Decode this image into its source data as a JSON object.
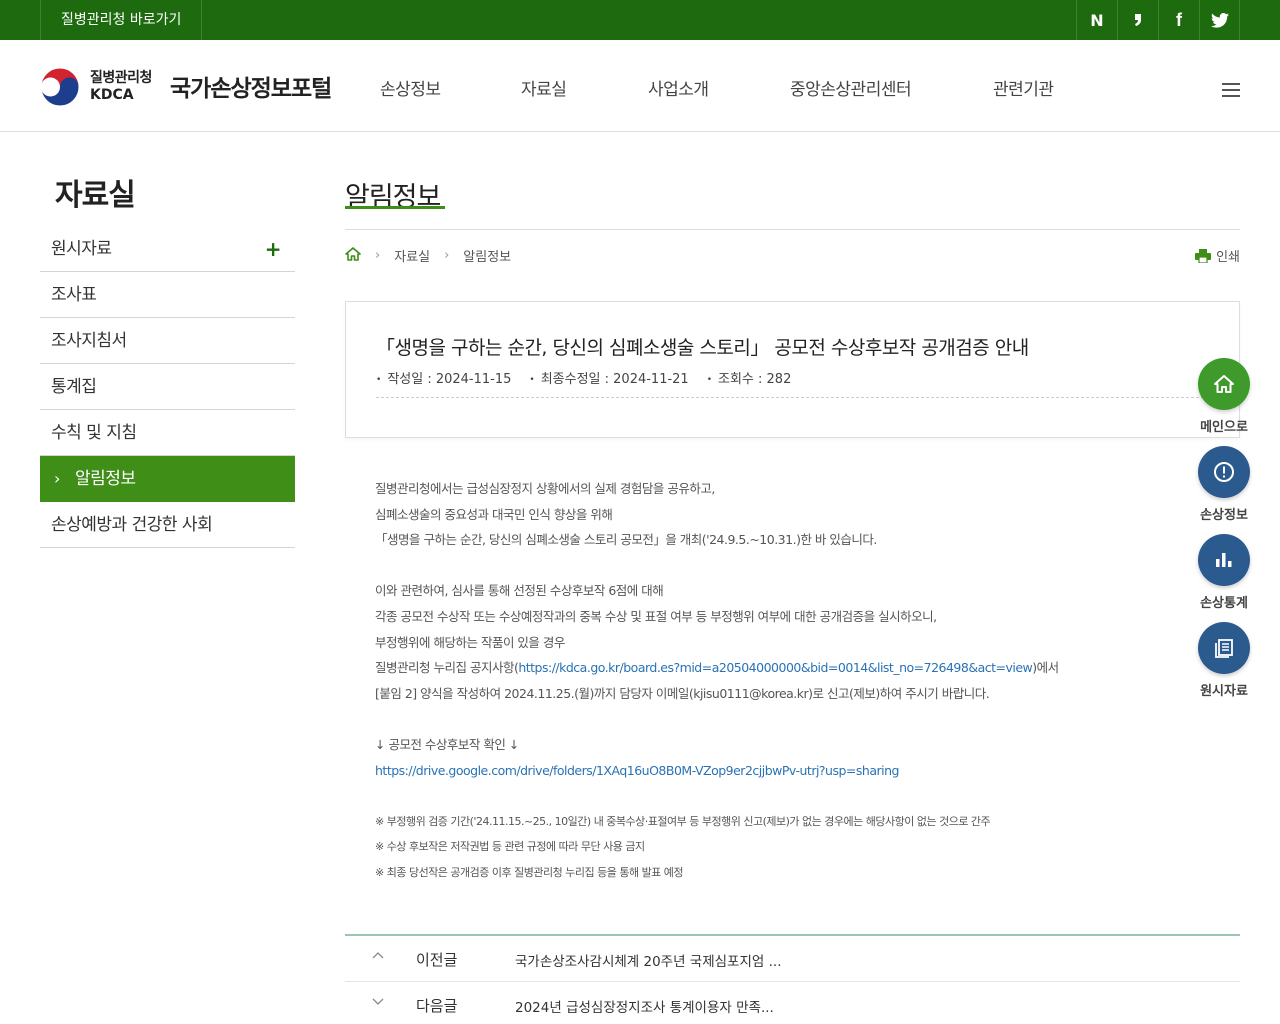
{
  "topbar": {
    "link_label": "질병관리청 바로가기",
    "sns": [
      {
        "icon": "naver-icon",
        "glyph": "N"
      },
      {
        "icon": "blog-icon",
        "glyph": "❜"
      },
      {
        "icon": "facebook-icon",
        "glyph": "f"
      },
      {
        "icon": "twitter-icon",
        "glyph": "t"
      }
    ]
  },
  "header": {
    "logo_ko": "질병관리청",
    "logo_en": "KDCA",
    "portal_title": "국가손상정보포털",
    "nav": [
      "손상정보",
      "자료실",
      "사업소개",
      "중앙손상관리센터",
      "관련기관"
    ]
  },
  "sidebar": {
    "title": "자료실",
    "items": [
      {
        "label": "원시자료",
        "expand": "+"
      },
      {
        "label": "조사표"
      },
      {
        "label": "조사지침서"
      },
      {
        "label": "통계집"
      },
      {
        "label": "수칙 및 지침"
      },
      {
        "label": "알림정보",
        "active": true
      },
      {
        "label": "손상예방과 건강한 사회"
      }
    ]
  },
  "content": {
    "page_title": "알림정보",
    "breadcrumb": [
      "자료실",
      "알림정보"
    ],
    "print_label": "인쇄"
  },
  "post": {
    "title": "「생명을 구하는 순간, 당신의 심폐소생술 스토리」 공모전 수상후보작 공개검증 안내",
    "meta": {
      "created": "작성일 : 2024-11-15",
      "modified": "최종수정일 : 2024-11-21",
      "views": "조회수 : 282"
    },
    "body": {
      "p1": "질병관리청에서는 급성심장정지 상황에서의 실제 경험담을 공유하고,",
      "p2": "심폐소생술의 중요성과 대국민 인식 향상을 위해",
      "p3": "「생명을 구하는 순간, 당신의 심폐소생술 스토리 공모전」을 개최('24.9.5.~10.31.)한 바 있습니다.",
      "p4": "이와 관련하여, 심사를 통해 선정된 수상후보작 6점에 대해",
      "p5": "각종 공모전 수상작 또는 수상예정작과의 중복 수상 및 표절 여부 등 부정행위 여부에 대한 공개검증을 실시하오니,",
      "p6": "부정행위에 해당하는 작품이 있을 경우",
      "p7_pre": "질병관리청 누리집 공지사항(",
      "p7_link": "https://kdca.go.kr/board.es?mid=a20504000000&bid=0014&list_no=726498&act=view",
      "p7_post": ")에서",
      "p8": "[붙임 2] 양식을 작성하여 2024.11.25.(월)까지 담당자 이메일(kjisu0111@korea.kr)로 신고(제보)하여 주시기 바랍니다.",
      "p9": "↓ 공모전 수상후보작 확인 ↓",
      "p10_link": "https://drive.google.com/drive/folders/1XAq16uO8B0M-VZop9er2cjjbwPv-utrj?usp=sharing",
      "n1": "※ 부정행위 검증 기간('24.11.15.~25., 10일간) 내 중복수상·표절여부 등 부정행위 신고(제보)가 없는 경우에는 해당사항이 없는 것으로 간주",
      "n2": "※ 수상 후보작은 저작권법 등 관련 규정에 따라 무단 사용 금지",
      "n3": "※ 최종 당선작은 공개검증 이후 질병관리청 누리집 등을 통해 발표 예정"
    }
  },
  "prevnext": {
    "prev_label": "이전글",
    "prev_title": "국가손상조사감시체계 20주년 국제심포지엄 ...",
    "next_label": "다음글",
    "next_title": "2024년 급성심장정지조사 통계이용자 만족..."
  },
  "quick_menu": [
    {
      "label": "메인으로",
      "icon": "home-icon",
      "color": "#3e9a2a"
    },
    {
      "label": "손상정보",
      "icon": "alert-icon",
      "color": "#2b5a8f"
    },
    {
      "label": "손상통계",
      "icon": "bar-chart-icon",
      "color": "#2b5a8f"
    },
    {
      "label": "원시자료",
      "icon": "document-icon",
      "color": "#2b5a8f"
    }
  ],
  "colors": {
    "topbar": "#1e6a0f",
    "accent_green": "#3e8e17",
    "link_blue": "#2a72b5",
    "quick_blue": "#2b5a8f"
  }
}
